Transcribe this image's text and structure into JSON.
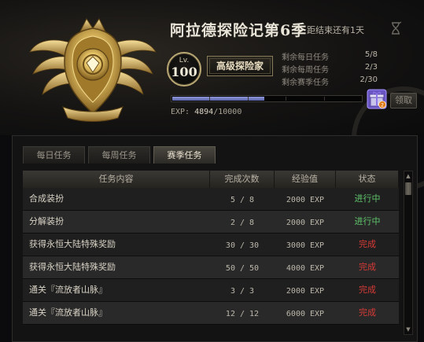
{
  "header": {
    "title": "阿拉德探险记第6季",
    "countdown": "距结束还有1天",
    "level_label": "Lv.",
    "level": "100",
    "rank": "高级探险家",
    "stats": [
      {
        "label": "剩余每日任务",
        "value": "5/8"
      },
      {
        "label": "剩余每周任务",
        "value": "2/3"
      },
      {
        "label": "剩余赛季任务",
        "value": "2/30"
      }
    ],
    "exp_label": "EXP:",
    "exp_current": "4894",
    "exp_total": "/10000",
    "exp_progress": 0.4894,
    "claim_label": "领取"
  },
  "tabs": [
    {
      "label": "每日任务",
      "active": false
    },
    {
      "label": "每周任务",
      "active": false
    },
    {
      "label": "赛季任务",
      "active": true
    }
  ],
  "table": {
    "headers": [
      "任务内容",
      "完成次数",
      "经验值",
      "状态"
    ],
    "rows": [
      {
        "name": "合成装扮",
        "count": "5 / 8",
        "exp": "2000 EXP",
        "status": "进行中",
        "status_type": "progress"
      },
      {
        "name": "分解装扮",
        "count": "2 / 8",
        "exp": "2000 EXP",
        "status": "进行中",
        "status_type": "progress"
      },
      {
        "name": "获得永恒大陆特殊奖励",
        "count": "30 / 30",
        "exp": "3000 EXP",
        "status": "完成",
        "status_type": "done"
      },
      {
        "name": "获得永恒大陆特殊奖励",
        "count": "50 / 50",
        "exp": "4000 EXP",
        "status": "完成",
        "status_type": "done"
      },
      {
        "name": "通关『流放者山脉』",
        "count": "3 / 3",
        "exp": "2000 EXP",
        "status": "完成",
        "status_type": "done"
      },
      {
        "name": "通关『流放者山脉』",
        "count": "12 / 12",
        "exp": "6000 EXP",
        "status": "完成",
        "status_type": "done"
      }
    ]
  },
  "colors": {
    "status_progress": "#5fc46a",
    "status_done": "#d83a35",
    "exp_fill": "#7a82c8",
    "gold": "#d8b85a"
  },
  "icons": {
    "emblem": "gold-adventure-emblem",
    "countdown": "hourglass-icon",
    "gift": "gift-box-icon"
  }
}
